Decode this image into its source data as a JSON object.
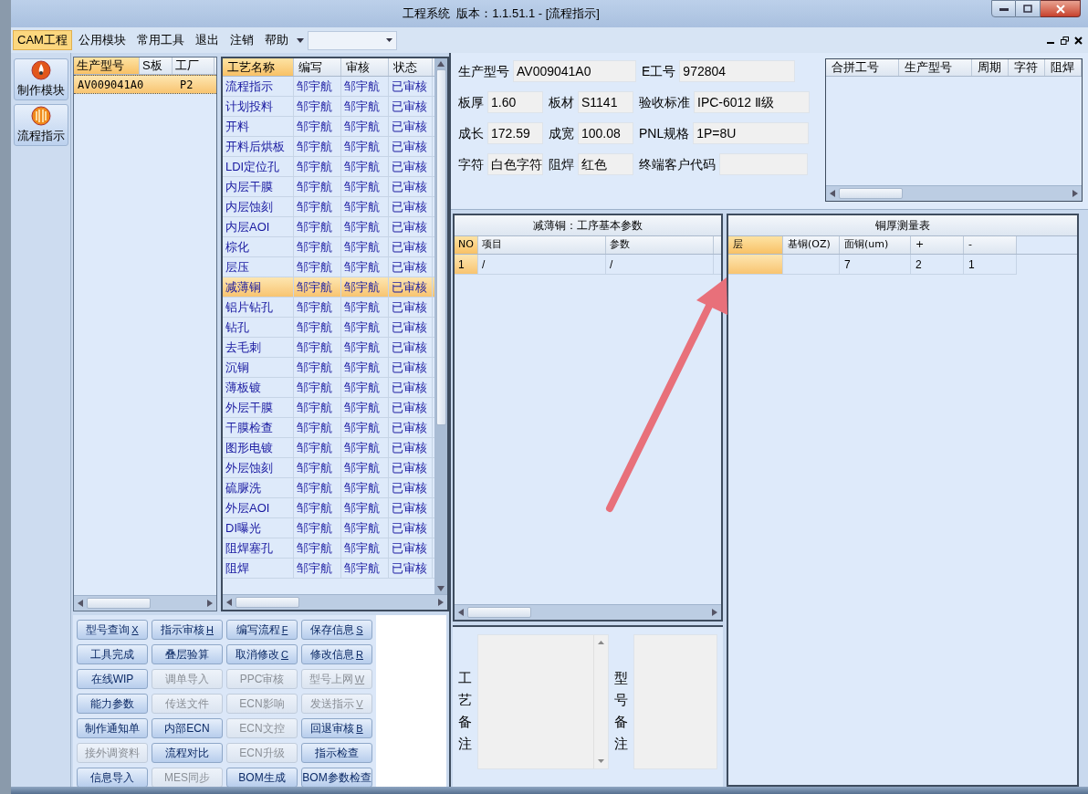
{
  "window": {
    "title": "工程系统  版本：1.1.51.1 - [流程指示]"
  },
  "menu": [
    {
      "label": "CAM工程",
      "selected": true
    },
    {
      "label": "公用模块",
      "selected": false
    },
    {
      "label": "常用工具",
      "selected": false
    },
    {
      "label": "退出",
      "selected": false
    },
    {
      "label": "注销",
      "selected": false
    },
    {
      "label": "帮助",
      "selected": false
    }
  ],
  "nav": [
    {
      "label": "制作模块",
      "kind": "flame"
    },
    {
      "label": "流程指示",
      "kind": "ball"
    }
  ],
  "products": {
    "columns": [
      "生产型号",
      "S板",
      "工厂"
    ],
    "rows": [
      {
        "model": "AV009041A0",
        "factory": "P2",
        "selected": true
      }
    ]
  },
  "processes": {
    "columns": [
      "工艺名称",
      "编写",
      "审核",
      "状态"
    ],
    "rows": [
      {
        "name": "流程指示",
        "author": "邹宇航",
        "reviewer": "邹宇航",
        "status": "已审核",
        "selected": false
      },
      {
        "name": "计划投料",
        "author": "邹宇航",
        "reviewer": "邹宇航",
        "status": "已审核",
        "selected": false
      },
      {
        "name": "开料",
        "author": "邹宇航",
        "reviewer": "邹宇航",
        "status": "已审核",
        "selected": false
      },
      {
        "name": "开料后烘板",
        "author": "邹宇航",
        "reviewer": "邹宇航",
        "status": "已审核",
        "selected": false
      },
      {
        "name": "LDI定位孔",
        "author": "邹宇航",
        "reviewer": "邹宇航",
        "status": "已审核",
        "selected": false
      },
      {
        "name": "内层干膜",
        "author": "邹宇航",
        "reviewer": "邹宇航",
        "status": "已审核",
        "selected": false
      },
      {
        "name": "内层蚀刻",
        "author": "邹宇航",
        "reviewer": "邹宇航",
        "status": "已审核",
        "selected": false
      },
      {
        "name": "内层AOI",
        "author": "邹宇航",
        "reviewer": "邹宇航",
        "status": "已审核",
        "selected": false
      },
      {
        "name": "棕化",
        "author": "邹宇航",
        "reviewer": "邹宇航",
        "status": "已审核",
        "selected": false
      },
      {
        "name": "层压",
        "author": "邹宇航",
        "reviewer": "邹宇航",
        "status": "已审核",
        "selected": false
      },
      {
        "name": "减薄铜",
        "author": "邹宇航",
        "reviewer": "邹宇航",
        "status": "已审核",
        "selected": true
      },
      {
        "name": "铝片钻孔",
        "author": "邹宇航",
        "reviewer": "邹宇航",
        "status": "已审核",
        "selected": false
      },
      {
        "name": "钻孔",
        "author": "邹宇航",
        "reviewer": "邹宇航",
        "status": "已审核",
        "selected": false
      },
      {
        "name": "去毛刺",
        "author": "邹宇航",
        "reviewer": "邹宇航",
        "status": "已审核",
        "selected": false
      },
      {
        "name": "沉铜",
        "author": "邹宇航",
        "reviewer": "邹宇航",
        "status": "已审核",
        "selected": false
      },
      {
        "name": "薄板镀",
        "author": "邹宇航",
        "reviewer": "邹宇航",
        "status": "已审核",
        "selected": false
      },
      {
        "name": "外层干膜",
        "author": "邹宇航",
        "reviewer": "邹宇航",
        "status": "已审核",
        "selected": false
      },
      {
        "name": "干膜检查",
        "author": "邹宇航",
        "reviewer": "邹宇航",
        "status": "已审核",
        "selected": false
      },
      {
        "name": "图形电镀",
        "author": "邹宇航",
        "reviewer": "邹宇航",
        "status": "已审核",
        "selected": false
      },
      {
        "name": "外层蚀刻",
        "author": "邹宇航",
        "reviewer": "邹宇航",
        "status": "已审核",
        "selected": false
      },
      {
        "name": "硫脲洗",
        "author": "邹宇航",
        "reviewer": "邹宇航",
        "status": "已审核",
        "selected": false
      },
      {
        "name": "外层AOI",
        "author": "邹宇航",
        "reviewer": "邹宇航",
        "status": "已审核",
        "selected": false
      },
      {
        "name": "DI曝光",
        "author": "邹宇航",
        "reviewer": "邹宇航",
        "status": "已审核",
        "selected": false
      },
      {
        "name": "阻焊塞孔",
        "author": "邹宇航",
        "reviewer": "邹宇航",
        "status": "已审核",
        "selected": false
      },
      {
        "name": "阻焊",
        "author": "邹宇航",
        "reviewer": "邹宇航",
        "status": "已审核",
        "selected": false
      }
    ]
  },
  "buttons": [
    {
      "label": "型号查询",
      "shortcut": "X",
      "disabled": false
    },
    {
      "label": "指示审核",
      "shortcut": "H",
      "disabled": false
    },
    {
      "label": "编写流程",
      "shortcut": "F",
      "disabled": false
    },
    {
      "label": "保存信息",
      "shortcut": "S",
      "disabled": false
    },
    {
      "label": "工具完成",
      "disabled": false
    },
    {
      "label": "叠层验算",
      "disabled": false
    },
    {
      "label": "取消修改",
      "shortcut": "C",
      "disabled": false
    },
    {
      "label": "修改信息",
      "shortcut": "R",
      "disabled": false
    },
    {
      "label": "在线WIP",
      "disabled": false
    },
    {
      "label": "调单导入",
      "disabled": true
    },
    {
      "label": "PPC审核",
      "disabled": true
    },
    {
      "label": "型号上网",
      "shortcut": "W",
      "disabled": true
    },
    {
      "label": "能力参数",
      "disabled": false
    },
    {
      "label": "传送文件",
      "disabled": true
    },
    {
      "label": "ECN影响",
      "disabled": true
    },
    {
      "label": "发送指示",
      "shortcut": "V",
      "disabled": true
    },
    {
      "label": "制作通知单",
      "disabled": false
    },
    {
      "label": "内部ECN",
      "disabled": false
    },
    {
      "label": "ECN文控",
      "disabled": true
    },
    {
      "label": "回退审核",
      "shortcut": "B",
      "disabled": false
    },
    {
      "label": "接外调资料",
      "disabled": true
    },
    {
      "label": "流程对比",
      "disabled": false
    },
    {
      "label": "ECN升级",
      "disabled": true
    },
    {
      "label": "指示检查",
      "disabled": false
    },
    {
      "label": "信息导入",
      "disabled": false
    },
    {
      "label": "MES同步",
      "disabled": true
    },
    {
      "label": "BOM生成",
      "disabled": false
    },
    {
      "label": "BOM参数检查",
      "disabled": false
    }
  ],
  "info": {
    "rows": [
      [
        {
          "label": "生产型号",
          "value": "AV009041A0"
        },
        "",
        {
          "label": "E工号",
          "value": "972804"
        }
      ],
      [
        {
          "label": "板厚",
          "value": "1.60"
        },
        {
          "label": "板材",
          "value": "S1141"
        },
        {
          "label": "验收标准",
          "value": "IPC-6012 Ⅱ级"
        }
      ],
      [
        {
          "label": "成长",
          "value": "172.59"
        },
        {
          "label": "成宽",
          "value": "100.08"
        },
        {
          "label": "PNL规格",
          "value": "1P=8U"
        }
      ],
      [
        {
          "label": "字符",
          "value": "白色字符"
        },
        {
          "label": "阻焊",
          "value": "红色"
        },
        {
          "label": "终端客户代码"
        }
      ]
    ]
  },
  "merge_table": {
    "columns": [
      "合拼工号",
      "生产型号",
      "周期",
      "字符",
      "阻焊"
    ]
  },
  "params_panel": {
    "title": "减薄铜：工序基本参数",
    "columns": [
      "NO",
      "项目",
      "参数"
    ],
    "rows": [
      {
        "no": "1",
        "item": "/",
        "value": "/",
        "selected": true
      }
    ]
  },
  "copper_panel": {
    "title": "铜厚测量表",
    "columns": [
      "层",
      "基铜(OZ)",
      "面铜(um)",
      "+",
      "-"
    ],
    "rows": [
      {
        "face": "7",
        "plus": "2",
        "minus": "1",
        "selected": true
      }
    ]
  },
  "notes": [
    {
      "label": "工艺备注"
    },
    {
      "label": "型号备注"
    }
  ]
}
